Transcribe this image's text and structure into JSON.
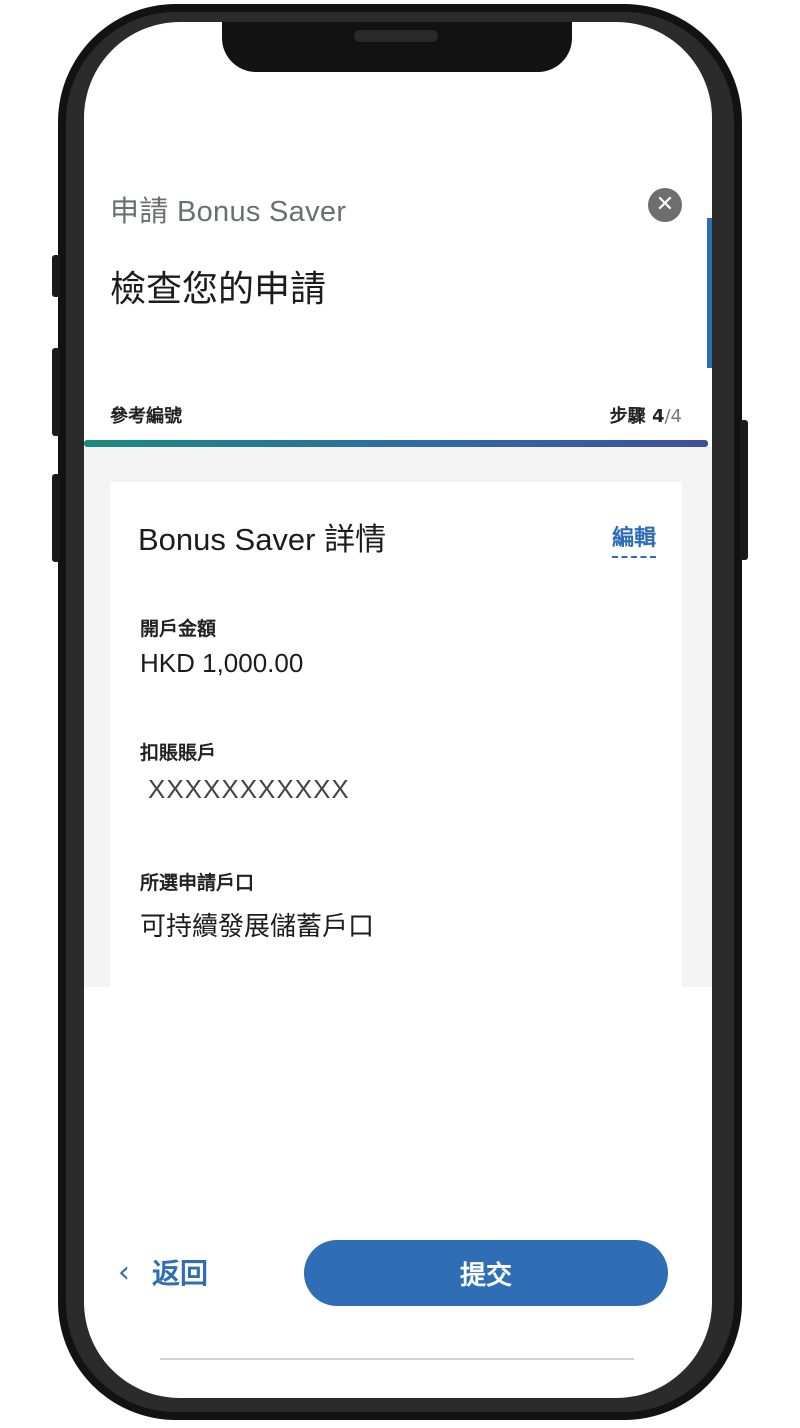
{
  "header": {
    "app_title": "申請 Bonus Saver",
    "close_symbol": "✕",
    "page_title": "檢查您的申請"
  },
  "progress": {
    "reference_label": "參考編號",
    "step_label": "步驟",
    "step_current": "4",
    "step_separator": "/",
    "step_total": "4",
    "fraction_complete": 1.0
  },
  "details_card": {
    "title": "Bonus Saver 詳情",
    "edit_label": "編輯",
    "fields": [
      {
        "label": "開戶金額",
        "value": "HKD 1,000.00"
      },
      {
        "label": "扣賬賬戶",
        "value": "XXXXXXXXXXX"
      },
      {
        "label": "所選申請戶口",
        "value": "可持續發展儲蓄戶口"
      }
    ]
  },
  "footer": {
    "back_symbol": "‹",
    "back_label": "返回",
    "submit_label": "提交"
  },
  "colors": {
    "accent": "#2f6db5",
    "progress_start": "#1d8a7e",
    "progress_end": "#3f4fa0",
    "close_button": "#6e6e6e"
  }
}
